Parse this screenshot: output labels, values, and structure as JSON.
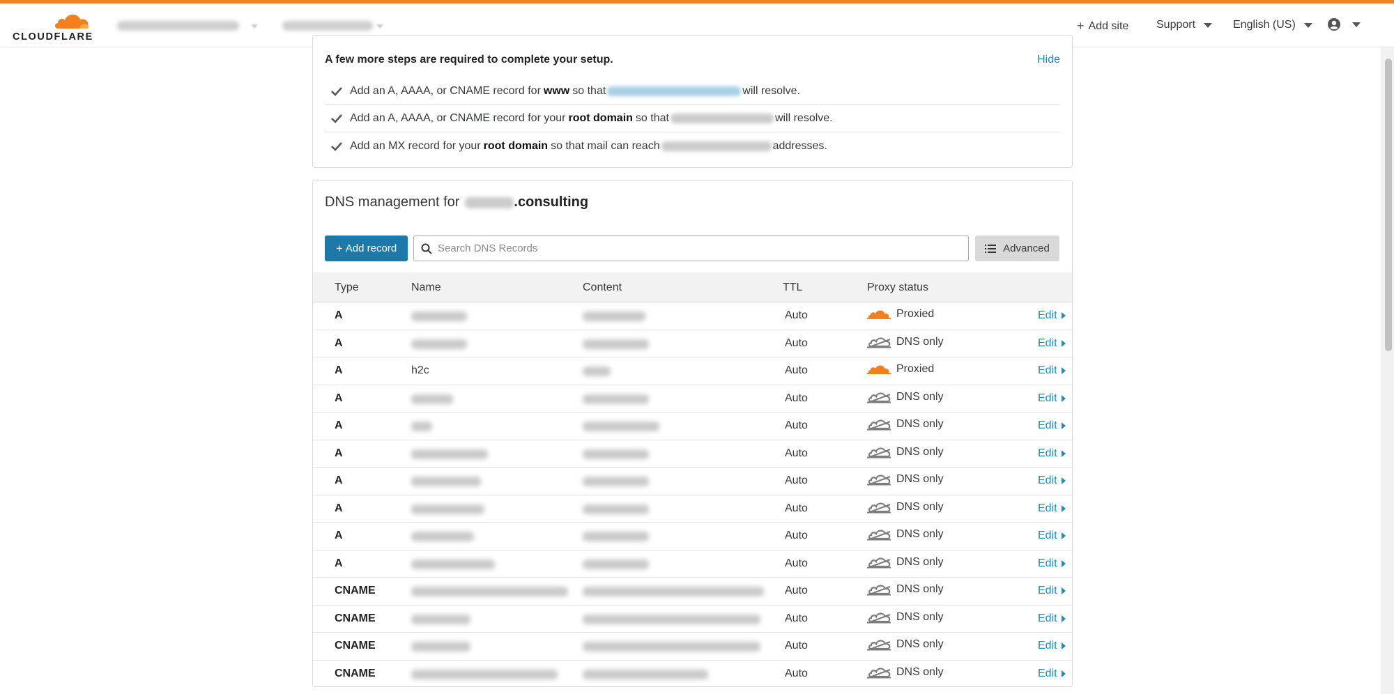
{
  "colors": {
    "accent": "#f38020",
    "link": "#1d8cbd",
    "primary_button": "#1f79a8"
  },
  "header": {
    "logo_text": "CLOUDFLARE",
    "add_site": "Add site",
    "support": "Support",
    "language": "English (US)",
    "account_icon": "user-circle-icon"
  },
  "setup": {
    "title": "A few more steps are required to complete your setup.",
    "hide": "Hide",
    "steps": [
      {
        "pre": "Add an A, AAAA, or CNAME record for",
        "bold": "www",
        "mid": "so that",
        "post": "will resolve."
      },
      {
        "pre": "Add an A, AAAA, or CNAME record for your",
        "bold": "root domain",
        "mid": "so that",
        "post": "will resolve."
      },
      {
        "pre": "Add an MX record for your",
        "bold": "root domain",
        "mid": "so that mail can reach",
        "post": "addresses."
      }
    ]
  },
  "dns": {
    "title_prefix": "DNS management for",
    "title_domain_suffix": ".consulting",
    "add_record": "Add record",
    "search_placeholder": "Search DNS Records",
    "advanced": "Advanced",
    "columns": {
      "type": "Type",
      "name": "Name",
      "content": "Content",
      "ttl": "TTL",
      "proxy": "Proxy status"
    },
    "edit_label": "Edit",
    "records": [
      {
        "type": "A",
        "name": "",
        "ttl": "Auto",
        "proxy": "Proxied",
        "proxied": true
      },
      {
        "type": "A",
        "name": "",
        "ttl": "Auto",
        "proxy": "DNS only",
        "proxied": false
      },
      {
        "type": "A",
        "name": "h2c",
        "ttl": "Auto",
        "proxy": "Proxied",
        "proxied": true
      },
      {
        "type": "A",
        "name": "",
        "ttl": "Auto",
        "proxy": "DNS only",
        "proxied": false
      },
      {
        "type": "A",
        "name": "",
        "ttl": "Auto",
        "proxy": "DNS only",
        "proxied": false
      },
      {
        "type": "A",
        "name": "",
        "ttl": "Auto",
        "proxy": "DNS only",
        "proxied": false
      },
      {
        "type": "A",
        "name": "",
        "ttl": "Auto",
        "proxy": "DNS only",
        "proxied": false
      },
      {
        "type": "A",
        "name": "",
        "ttl": "Auto",
        "proxy": "DNS only",
        "proxied": false
      },
      {
        "type": "A",
        "name": "",
        "ttl": "Auto",
        "proxy": "DNS only",
        "proxied": false
      },
      {
        "type": "A",
        "name": "",
        "ttl": "Auto",
        "proxy": "DNS only",
        "proxied": false
      },
      {
        "type": "CNAME",
        "name": "",
        "ttl": "Auto",
        "proxy": "DNS only",
        "proxied": false
      },
      {
        "type": "CNAME",
        "name": "",
        "ttl": "Auto",
        "proxy": "DNS only",
        "proxied": false
      },
      {
        "type": "CNAME",
        "name": "",
        "ttl": "Auto",
        "proxy": "DNS only",
        "proxied": false
      },
      {
        "type": "CNAME",
        "name": "",
        "ttl": "Auto",
        "proxy": "DNS only",
        "proxied": false
      }
    ]
  }
}
